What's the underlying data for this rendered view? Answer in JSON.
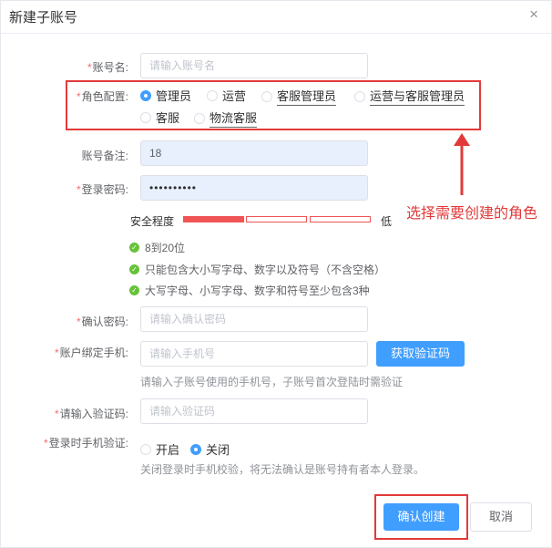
{
  "dialog": {
    "title": "新建子账号",
    "close_symbol": "×"
  },
  "form": {
    "required_mark": "*",
    "account_name": {
      "label": "账号名:",
      "placeholder": "请输入账号名"
    },
    "role": {
      "label": "角色配置:",
      "options": [
        {
          "label": "管理员",
          "checked": true
        },
        {
          "label": "运营",
          "checked": false
        },
        {
          "label": "客服管理员",
          "checked": false
        },
        {
          "label": "运营与客服管理员",
          "checked": false
        },
        {
          "label": "客服",
          "checked": false
        },
        {
          "label": "物流客服",
          "checked": false
        }
      ]
    },
    "remark": {
      "label": "账号备注:",
      "value": "18"
    },
    "password": {
      "label": "登录密码:",
      "value": "••••••••••",
      "strength_label": "安全程度",
      "strength_level": "低",
      "strength_filled_segments": 1,
      "strength_total_segments": 3,
      "rules": [
        "8到20位",
        "只能包含大小写字母、数字以及符号（不含空格）",
        "大写字母、小写字母、数字和符号至少包含3种"
      ]
    },
    "confirm_password": {
      "label": "确认密码:",
      "placeholder": "请输入确认密码"
    },
    "phone": {
      "label": "账户绑定手机:",
      "placeholder": "请输入手机号",
      "get_code_button": "获取验证码",
      "hint": "请输入子账号使用的手机号，子账号首次登陆时需验证"
    },
    "code": {
      "label": "请输入验证码:",
      "placeholder": "请输入验证码"
    },
    "login_verify": {
      "label": "登录时手机验证:",
      "options": [
        {
          "label": "开启",
          "checked": false
        },
        {
          "label": "关闭",
          "checked": true
        }
      ],
      "hint": "关闭登录时手机校验，将无法确认是账号持有者本人登录。"
    }
  },
  "annotation": {
    "text": "选择需要创建的角色",
    "color": "#e23a3a"
  },
  "footer": {
    "confirm": "确认创建",
    "cancel": "取消"
  },
  "colors": {
    "primary": "#409eff",
    "danger": "#e23a3a",
    "success": "#67c23a",
    "strength_low": "#f05454"
  }
}
